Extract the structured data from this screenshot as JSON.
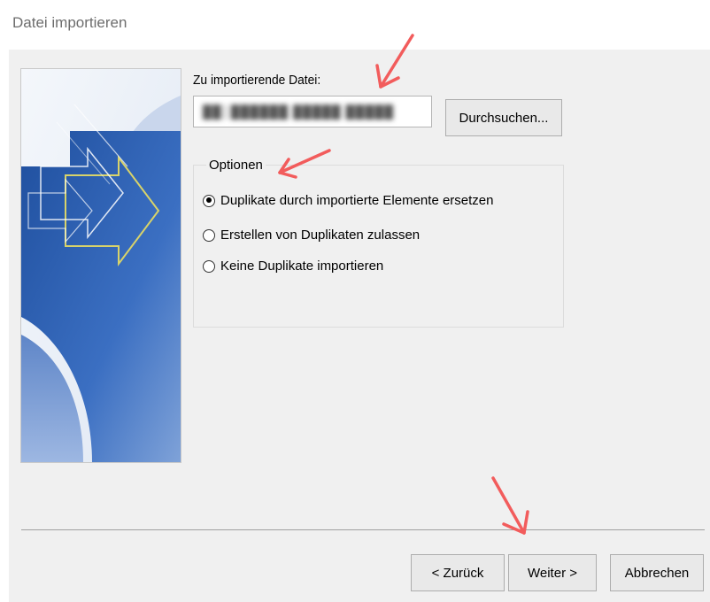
{
  "window": {
    "title": "Datei importieren"
  },
  "file": {
    "label": "Zu importierende Datei:",
    "value_obscured": "██│██████ █████ █████"
  },
  "browse_label": "Durchsuchen...",
  "options": {
    "legend": "Optionen",
    "items": [
      {
        "label": "Duplikate durch importierte Elemente ersetzen",
        "checked": true
      },
      {
        "label": "Erstellen von Duplikaten zulassen",
        "checked": false
      },
      {
        "label": "Keine Duplikate importieren",
        "checked": false
      }
    ]
  },
  "buttons": {
    "back": "< Zurück",
    "next": "Weiter >",
    "cancel": "Abbrechen"
  },
  "colors": {
    "annotation_arrow": "#f25c5c",
    "banner_blue": "#2d5fae",
    "dialog_bg": "#f0f0f0"
  },
  "icons": {
    "banner": "import-wizard-banner",
    "annotation": "red-arrow-annotation"
  }
}
